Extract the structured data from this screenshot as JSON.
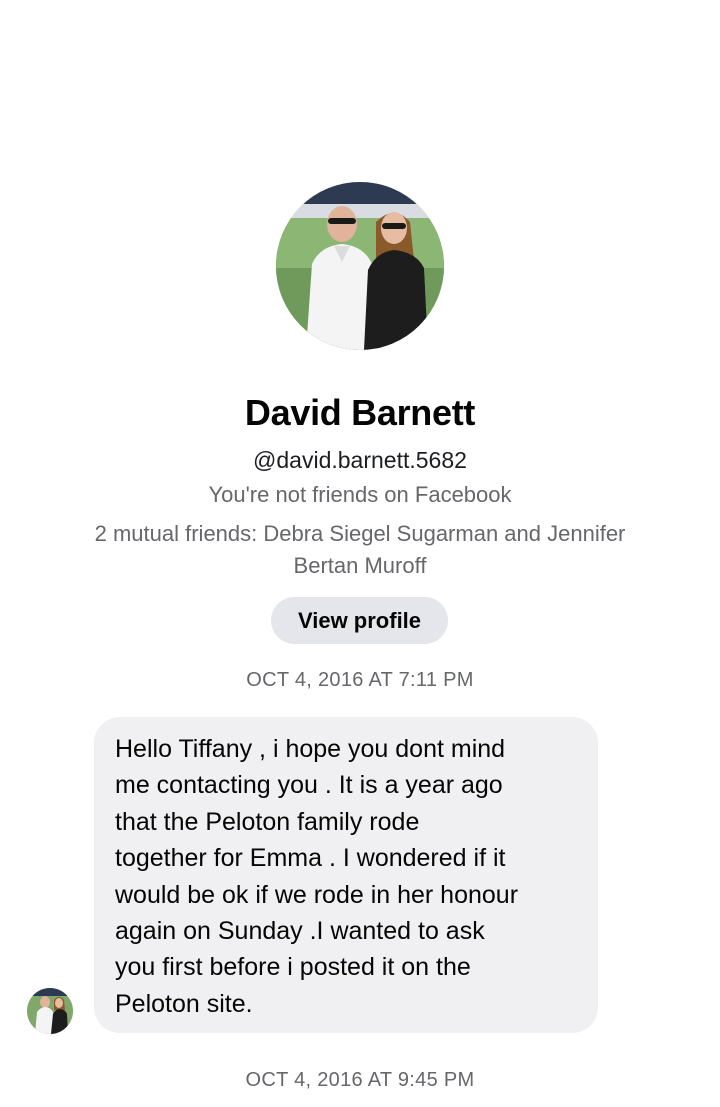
{
  "contact": {
    "name": "David Barnett",
    "username": "@david.barnett.5682",
    "friend_status": "You're not friends on Facebook",
    "mutual_friends_line1": "2 mutual friends: Debra Siegel Sugarman and Jennifer",
    "mutual_friends_line2": "Bertan Muroff",
    "view_profile_label": "View profile"
  },
  "conversation": {
    "timestamps": [
      "OCT 4, 2016 AT 7:11 PM",
      "OCT 4, 2016 AT 9:45 PM"
    ],
    "message": {
      "lines": [
        "Hello Tiffany , i hope you dont mind",
        "me contacting you . It is a year ago",
        "that the Peloton family rode",
        "together for Emma . I wondered if it",
        "would be ok if we rode in her honour",
        "again on Sunday .I wanted to ask",
        "you first before i posted it on the",
        "Peloton site."
      ]
    }
  },
  "colors": {
    "bubble_bg": "#f0f0f2",
    "button_bg": "#e4e6eb",
    "secondary_text": "#65676b",
    "primary_text": "#050505"
  }
}
